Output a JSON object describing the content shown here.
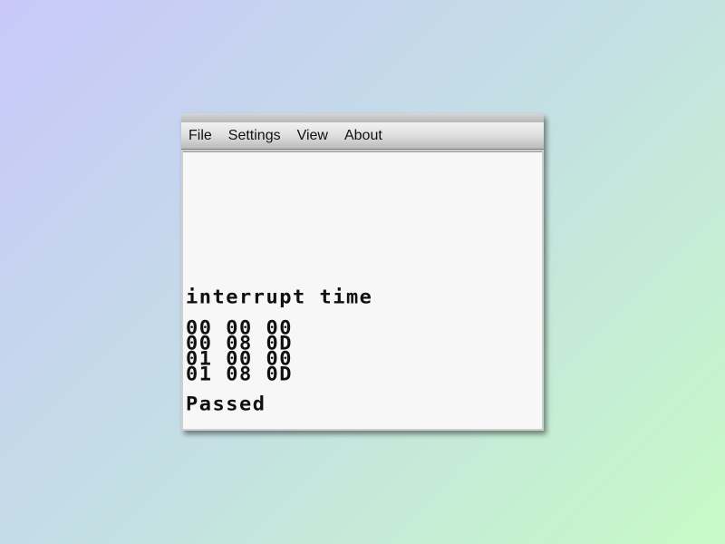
{
  "menu": {
    "items": [
      "File",
      "Settings",
      "View",
      "About"
    ]
  },
  "screen": {
    "heading": "interrupt time",
    "rows": [
      "00 00 00",
      "00 08 0D",
      "01 00 00",
      "01 08 0D"
    ],
    "result": "Passed"
  },
  "colors": {
    "background_gradient_start": "#c8c8fa",
    "background_gradient_end": "#c6fac6",
    "screen_background": "#f7f7f7",
    "text": "#101010"
  }
}
